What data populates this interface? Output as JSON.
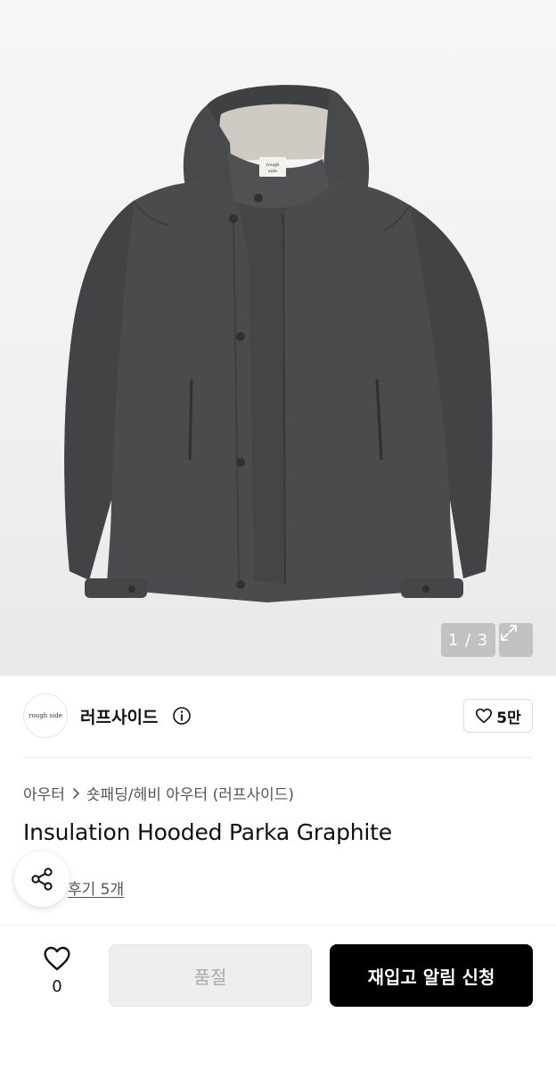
{
  "gallery": {
    "counter": "1 / 3",
    "brand_tag": [
      "rough",
      "side"
    ]
  },
  "brand": {
    "logo_text": "rough side",
    "name": "러프사이드",
    "like_count": "5만"
  },
  "breadcrumb": {
    "category": "아우터",
    "subcategory": "숏패딩/헤비 아우터 (러프사이드)"
  },
  "product": {
    "title": "Insulation Hooded Parka Graphite",
    "review_link": "후기 5개"
  },
  "bottom_bar": {
    "wish_count": "0",
    "soldout_label": "품절",
    "restock_label": "재입고 알림 신청"
  },
  "colors": {
    "primary_button": "#000000",
    "disabled_button": "#eeeeee",
    "jacket": "#4a4b4d"
  },
  "icons": {
    "expand": "expand-icon",
    "info": "info-icon",
    "heart": "heart-icon",
    "share": "share-icon",
    "chevron": "chevron-right-icon"
  }
}
